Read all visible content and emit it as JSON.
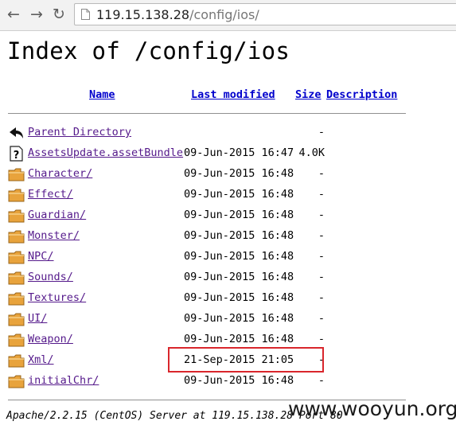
{
  "browser": {
    "url_host": "119.15.138.28",
    "url_path": "/config/ios/"
  },
  "page": {
    "title": "Index of /config/ios",
    "columns": {
      "name": "Name",
      "last_modified": "Last modified",
      "size": "Size",
      "description": "Description"
    },
    "rows": [
      {
        "icon": "back-arrow-icon",
        "name": "Parent Directory",
        "date": "",
        "size": "-"
      },
      {
        "icon": "unknown-file-icon",
        "name": "AssetsUpdate.assetBundle",
        "date": "09-Jun-2015 16:47",
        "size": "4.0K"
      },
      {
        "icon": "folder-icon",
        "name": "Character/",
        "date": "09-Jun-2015 16:48",
        "size": "-"
      },
      {
        "icon": "folder-icon",
        "name": "Effect/",
        "date": "09-Jun-2015 16:48",
        "size": "-"
      },
      {
        "icon": "folder-icon",
        "name": "Guardian/",
        "date": "09-Jun-2015 16:48",
        "size": "-"
      },
      {
        "icon": "folder-icon",
        "name": "Monster/",
        "date": "09-Jun-2015 16:48",
        "size": "-"
      },
      {
        "icon": "folder-icon",
        "name": "NPC/",
        "date": "09-Jun-2015 16:48",
        "size": "-"
      },
      {
        "icon": "folder-icon",
        "name": "Sounds/",
        "date": "09-Jun-2015 16:48",
        "size": "-"
      },
      {
        "icon": "folder-icon",
        "name": "Textures/",
        "date": "09-Jun-2015 16:48",
        "size": "-"
      },
      {
        "icon": "folder-icon",
        "name": "UI/",
        "date": "09-Jun-2015 16:48",
        "size": "-"
      },
      {
        "icon": "folder-icon",
        "name": "Weapon/",
        "date": "09-Jun-2015 16:48",
        "size": "-"
      },
      {
        "icon": "folder-icon",
        "name": "Xml/",
        "date": "21-Sep-2015 21:05",
        "size": "-"
      },
      {
        "icon": "folder-icon",
        "name": "initialChr/",
        "date": "09-Jun-2015 16:48",
        "size": "-"
      }
    ],
    "footer": "Apache/2.2.15 (CentOS) Server at 119.15.138.28 Port 80"
  },
  "watermark": "www.wooyun.org",
  "colors": {
    "link": "#551a8b",
    "header_link": "#0000cc",
    "highlight": "#d9262c",
    "folder": "#e8a33c"
  }
}
